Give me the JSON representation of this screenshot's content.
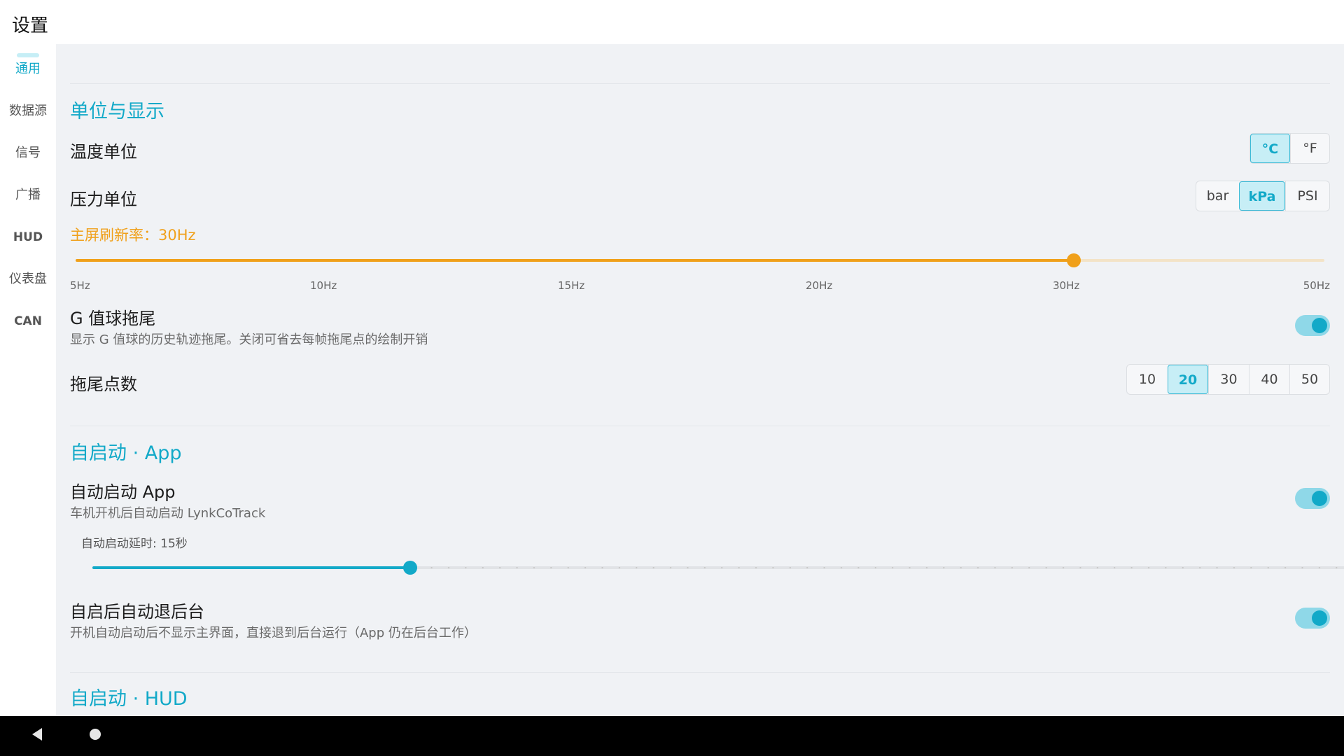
{
  "app": {
    "title": "设置"
  },
  "sidebar": {
    "items": [
      {
        "label": "通用"
      },
      {
        "label": "数据源"
      },
      {
        "label": "信号"
      },
      {
        "label": "广播"
      },
      {
        "label": "HUD"
      },
      {
        "label": "仪表盘"
      },
      {
        "label": "CAN"
      }
    ],
    "active_index": 0
  },
  "sections": {
    "units_display": {
      "title": "单位与显示",
      "temperature": {
        "label": "温度单位",
        "options": [
          "°C",
          "°F"
        ],
        "selected": "°C"
      },
      "pressure": {
        "label": "压力单位",
        "options": [
          "bar",
          "kPa",
          "PSI"
        ],
        "selected": "kPa"
      },
      "refresh": {
        "label": "主屏刷新率：30Hz",
        "ticks": [
          "5Hz",
          "10Hz",
          "15Hz",
          "20Hz",
          "30Hz",
          "50Hz"
        ],
        "value_index": 4
      },
      "g_trail": {
        "label": "G 值球拖尾",
        "desc": "显示 G 值球的历史轨迹拖尾。关闭可省去每帧拖尾点的绘制开销",
        "enabled": true
      },
      "trail_points": {
        "label": "拖尾点数",
        "options": [
          "10",
          "20",
          "30",
          "40",
          "50"
        ],
        "selected": "20"
      }
    },
    "autostart_app": {
      "title": "自启动 · App",
      "autostart": {
        "label": "自动启动 App",
        "desc": "车机开机后自动启动 LynkCoTrack",
        "enabled": true
      },
      "delay": {
        "label": "自动启动延时: 15秒",
        "value_fraction": 0.25
      },
      "background": {
        "label": "自启后自动退后台",
        "desc": "开机自动启动后不显示主界面，直接退到后台运行（App 仍在后台工作）",
        "enabled": true
      }
    },
    "autostart_hud": {
      "title": "自启动 · HUD"
    }
  },
  "colors": {
    "accent": "#12a9c8",
    "accent_light": "#c7eef6",
    "warning": "#f0a01a",
    "content_bg": "#f0f2f5"
  },
  "icons": {
    "back": "back-triangle-icon",
    "home": "home-circle-icon"
  }
}
